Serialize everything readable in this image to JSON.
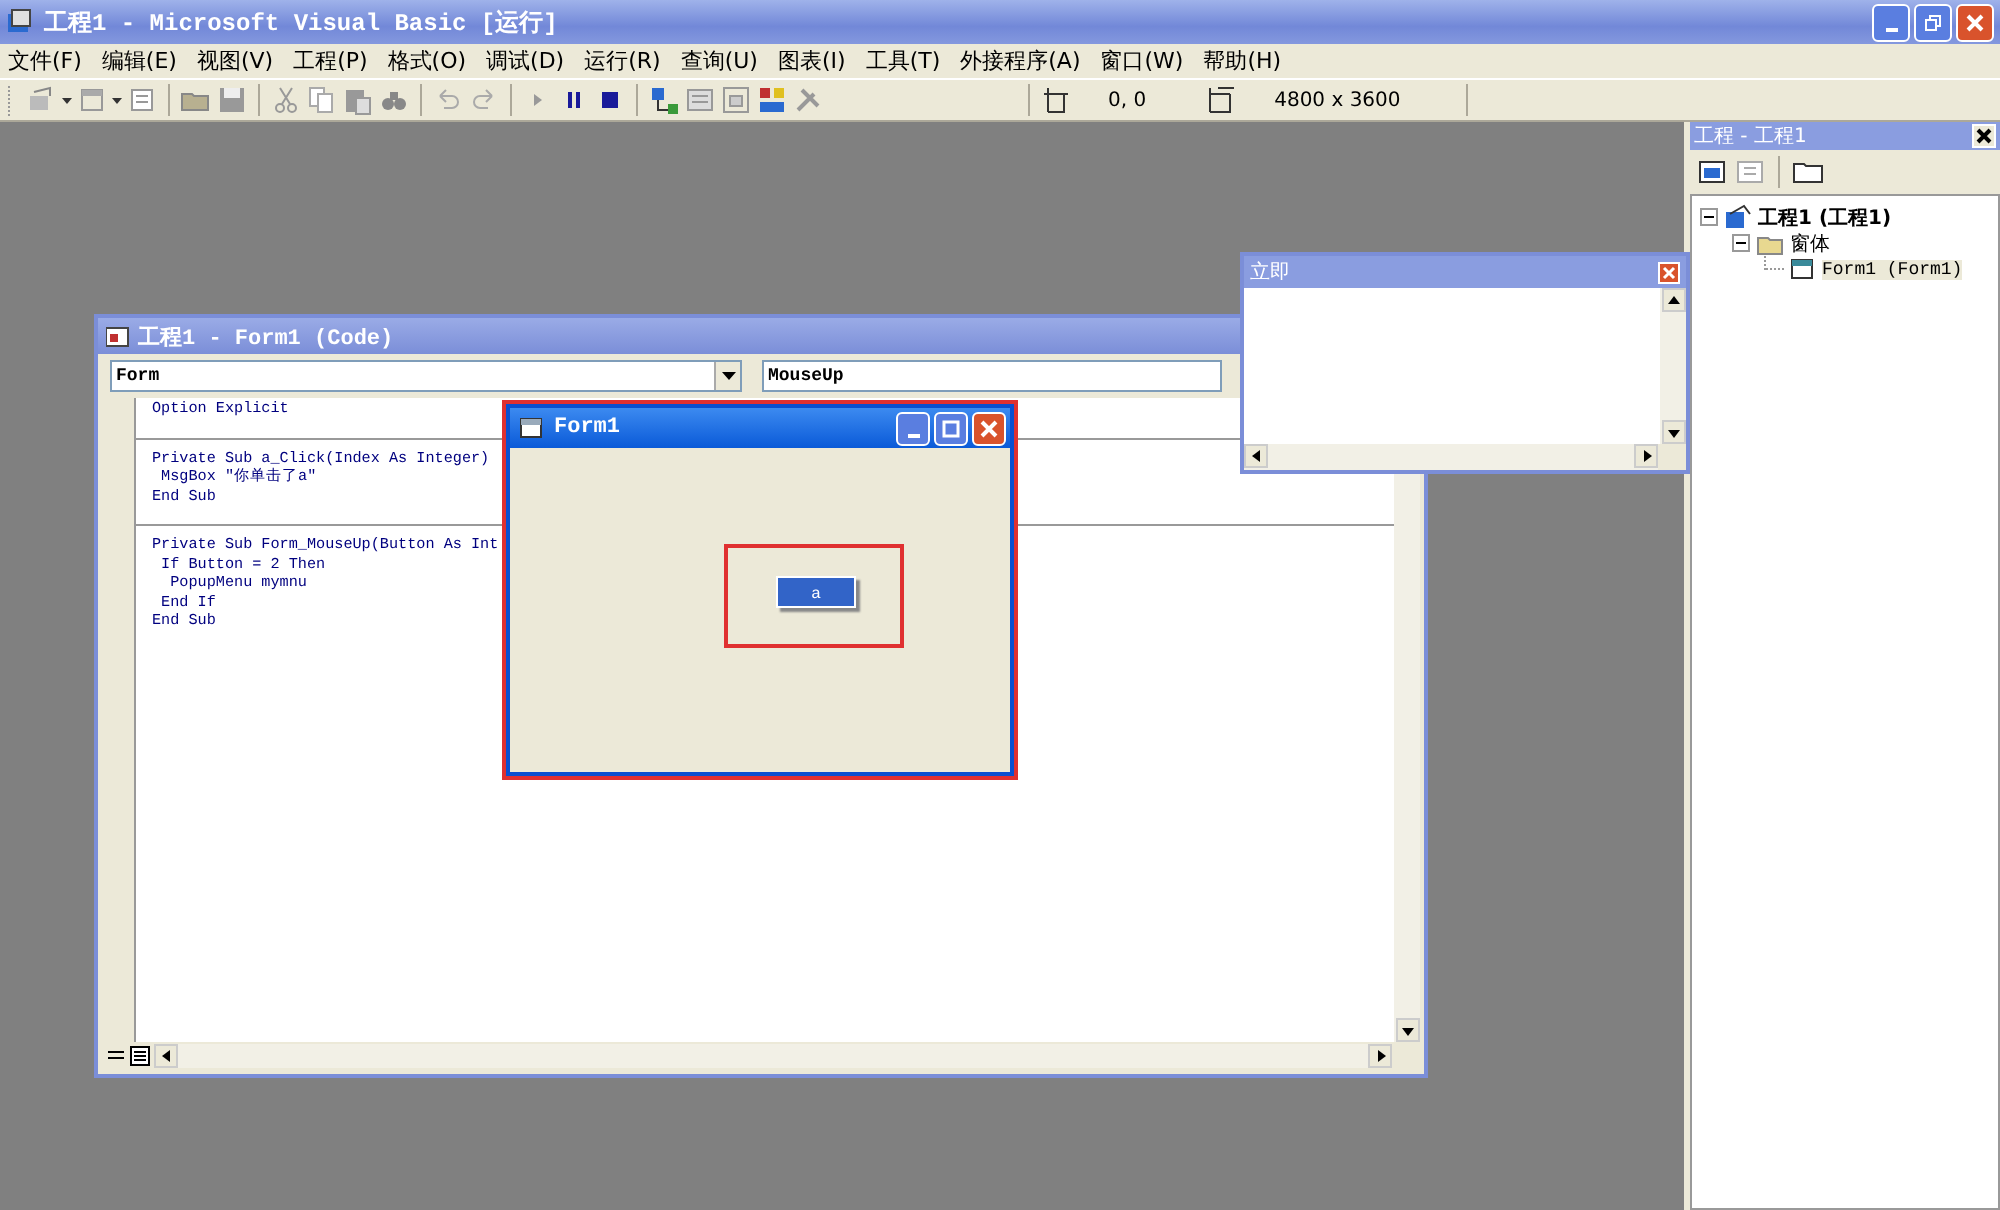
{
  "window": {
    "title": "工程1 - Microsoft Visual Basic [运行]"
  },
  "menu": [
    "文件(F)",
    "编辑(E)",
    "视图(V)",
    "工程(P)",
    "格式(O)",
    "调试(D)",
    "运行(R)",
    "查询(U)",
    "图表(I)",
    "工具(T)",
    "外接程序(A)",
    "窗口(W)",
    "帮助(H)"
  ],
  "toolbar": {
    "position": "0, 0",
    "size": "4800 x 3600"
  },
  "code_window": {
    "title": "工程1 - Form1 (Code)",
    "object": "Form",
    "procedure": "MouseUp",
    "procedures": [
      [
        "Option Explicit"
      ],
      [
        "Private Sub a_Click(Index As Integer)",
        " MsgBox \"你单击了a\"",
        "End Sub"
      ],
      [
        "Private Sub Form_MouseUp(Button As Int",
        " If Button = 2 Then",
        "  PopupMenu mymnu",
        " End If",
        "End Sub"
      ]
    ]
  },
  "form_window": {
    "title": "Form1",
    "button": "a",
    "highlighted": true
  },
  "immediate_window": {
    "title": "立即"
  },
  "project_pane": {
    "title": "工程 - 工程1",
    "tree": [
      {
        "label": "工程1 (工程1)",
        "kind": "project",
        "expanded": true,
        "children": [
          {
            "label": "窗体",
            "kind": "folder",
            "expanded": true,
            "children": [
              {
                "label": "Form1 (Form1)",
                "kind": "form",
                "selected": true
              }
            ]
          }
        ]
      }
    ]
  }
}
